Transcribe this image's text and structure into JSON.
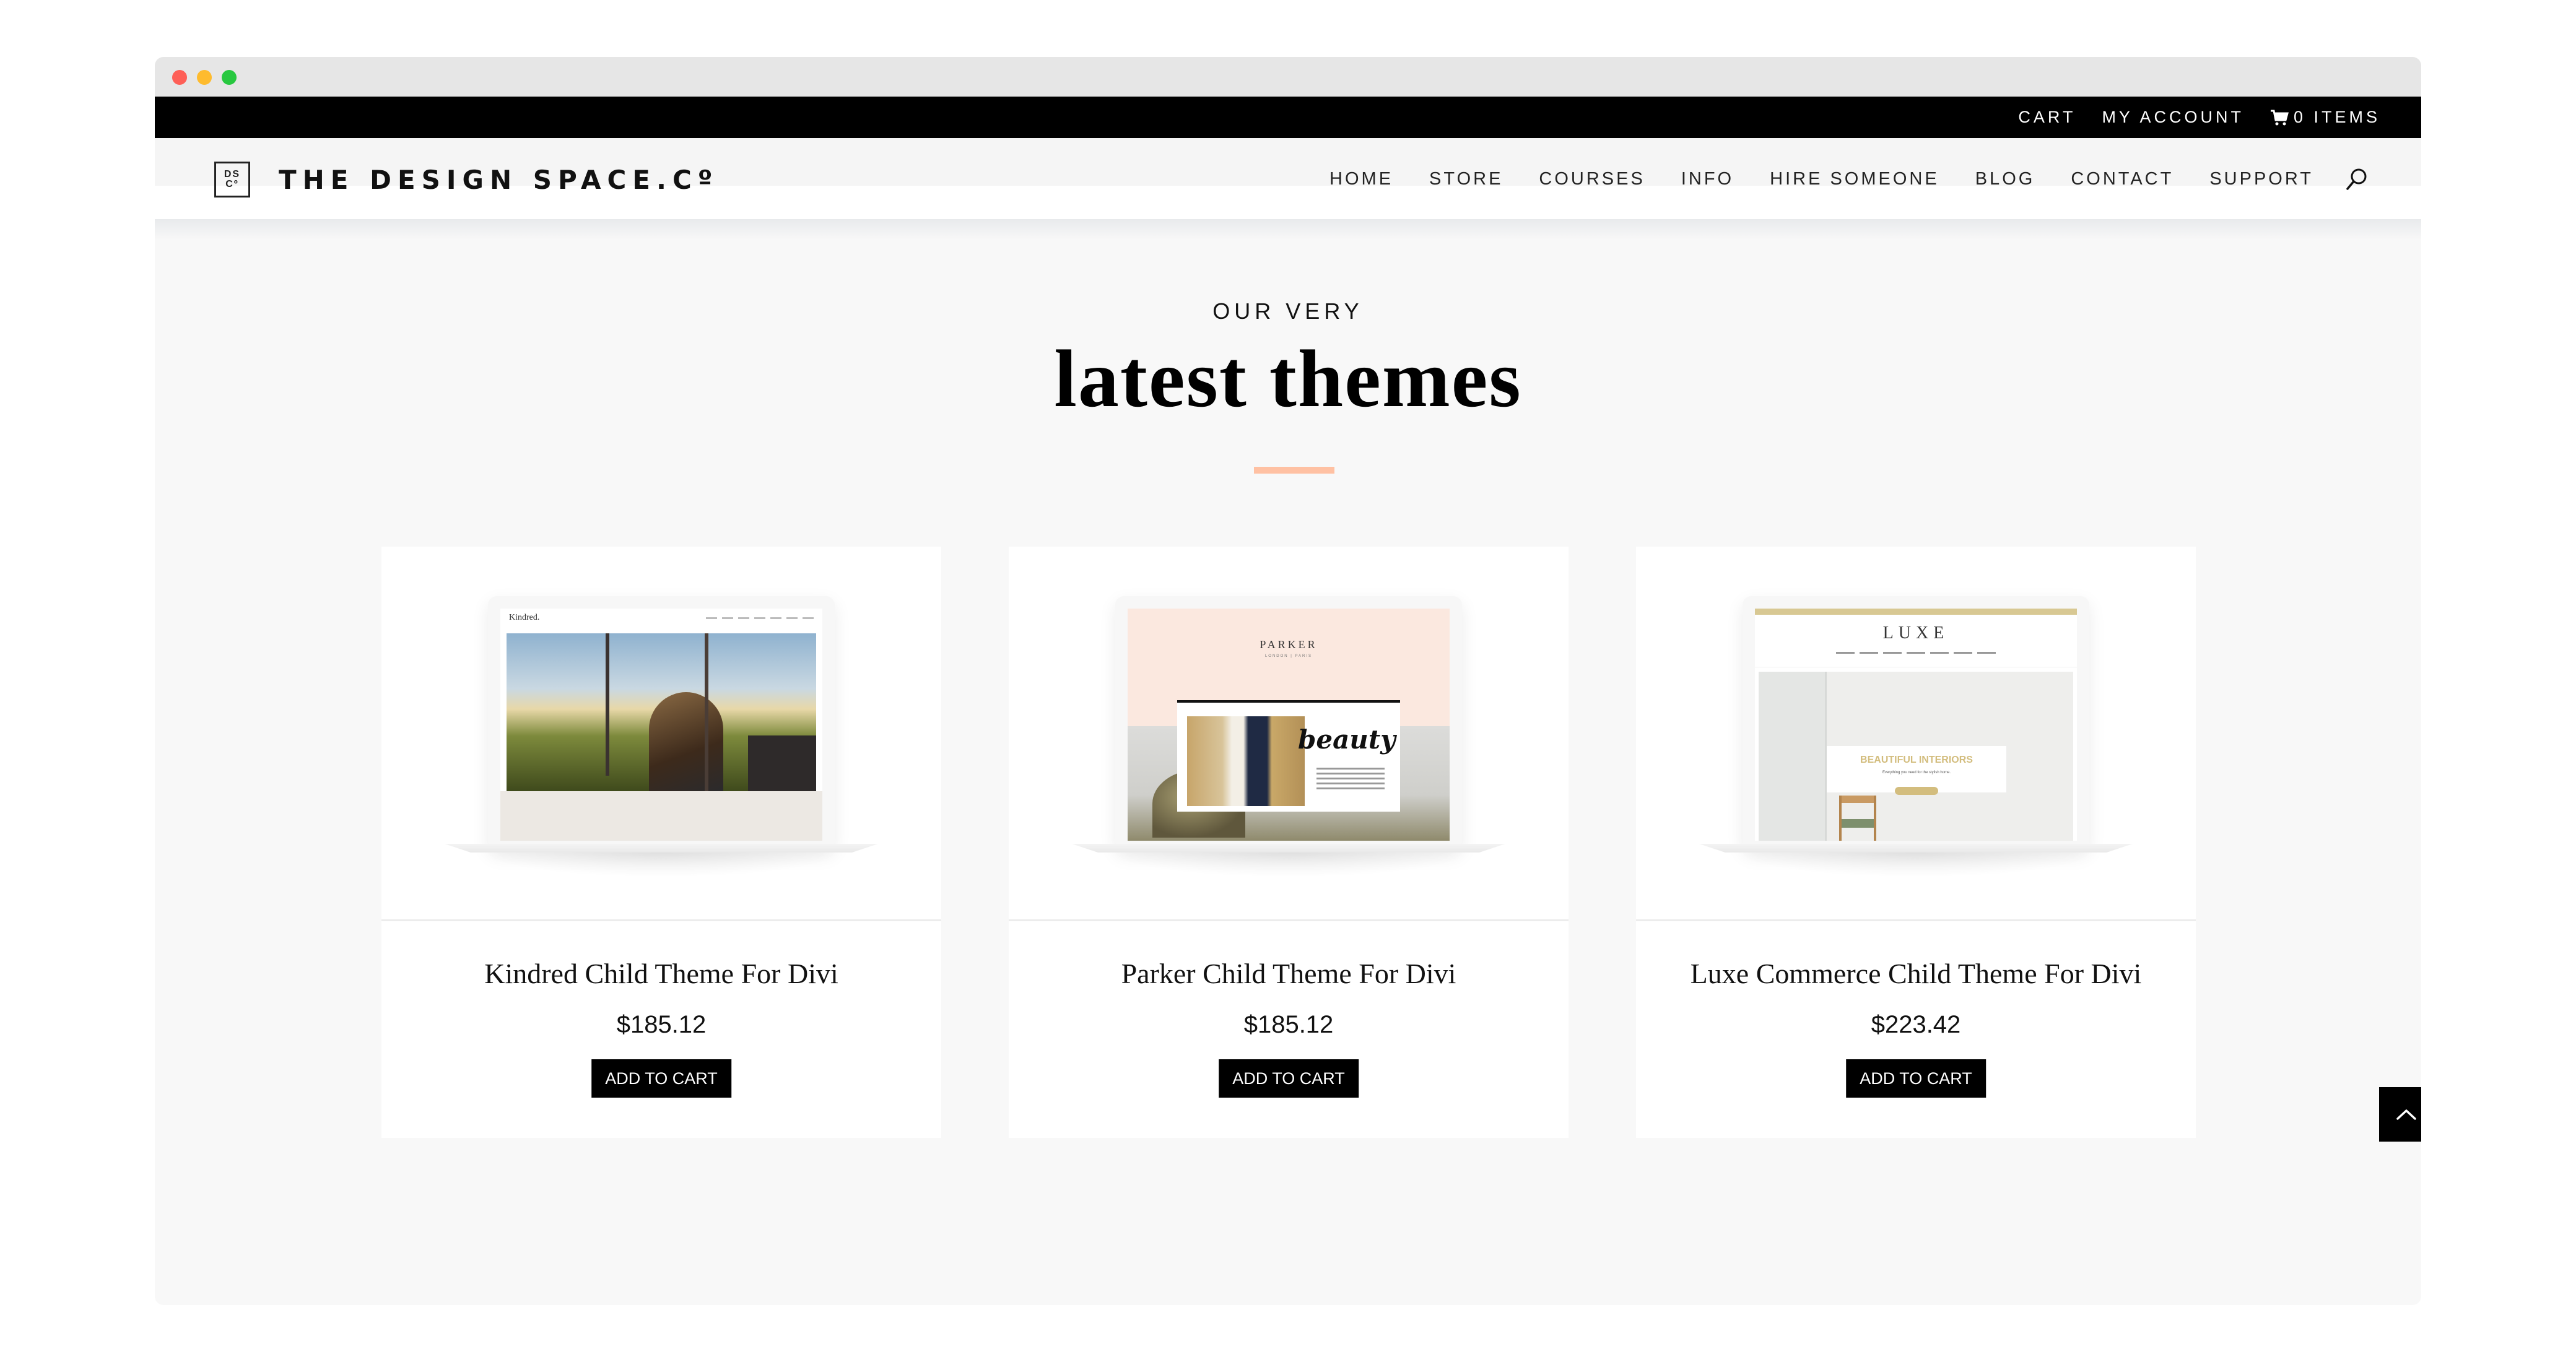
{
  "window": {
    "controls": [
      "close",
      "minimize",
      "maximize"
    ]
  },
  "topbar": {
    "links": [
      {
        "label": "CART",
        "icon": null
      },
      {
        "label": "MY ACCOUNT",
        "icon": null
      },
      {
        "label": "0 ITEMS",
        "icon": "cart-icon"
      }
    ]
  },
  "header": {
    "logo_mark_top": "DS",
    "logo_mark_bottom": "Cº",
    "logo_text": "THE DESIGN SPACE.Cº",
    "nav": [
      "HOME",
      "STORE",
      "COURSES",
      "INFO",
      "HIRE SOMEONE",
      "BLOG",
      "CONTACT",
      "SUPPORT"
    ],
    "search_icon": "search-icon"
  },
  "section": {
    "eyebrow": "OUR VERY",
    "title": "latest themes",
    "accent_color": "#ffc1a3"
  },
  "products": [
    {
      "title": "Kindred Child Theme For Divi",
      "price": "$185.12",
      "button": "ADD TO CART",
      "preview": {
        "brand": "Kindred."
      }
    },
    {
      "title": "Parker Child Theme For Divi",
      "price": "$185.12",
      "button": "ADD TO CART",
      "preview": {
        "brand": "PARKER",
        "sub": "LONDON | PARIS",
        "script": "beauty"
      }
    },
    {
      "title": "Luxe Commerce Child Theme For Divi",
      "price": "$223.42",
      "button": "ADD TO CART",
      "preview": {
        "brand": "LUXE",
        "hero_title": "BEAUTIFUL INTERIORS",
        "hero_sub": "Everything you need for the stylish home."
      }
    }
  ],
  "back_to_top": {
    "icon": "chevron-up-icon"
  }
}
